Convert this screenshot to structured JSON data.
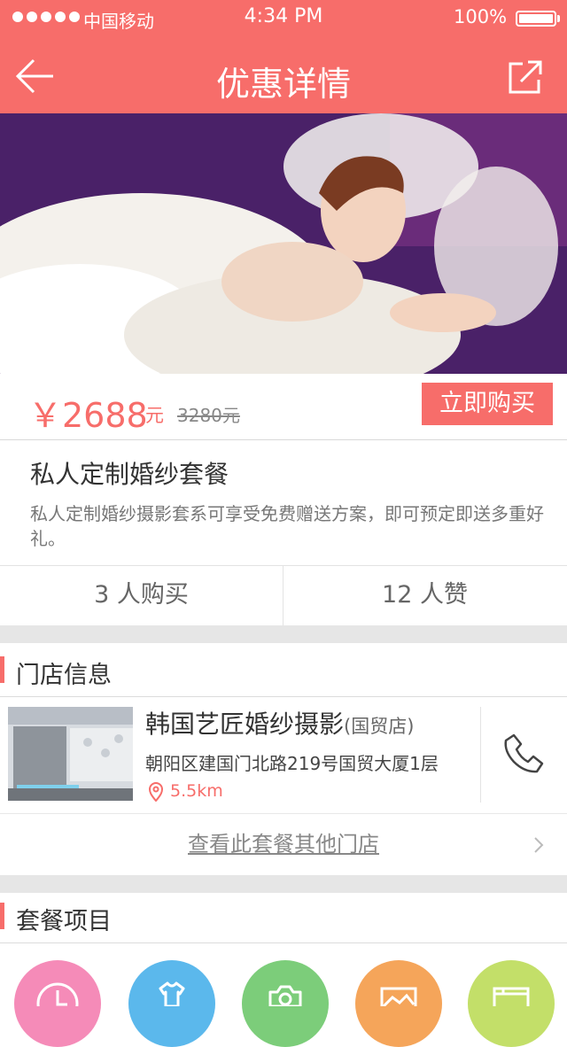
{
  "status_bar": {
    "carrier": "中国移动",
    "time": "4:34 PM",
    "battery": "100%"
  },
  "nav": {
    "title": "优惠详情"
  },
  "price": {
    "current": "￥2688",
    "unit": "元",
    "original": "3280元"
  },
  "buy_button": "立即购买",
  "package": {
    "title": "私人定制婚纱套餐",
    "description": "私人定制婚纱摄影套系可享受免费赠送方案，即可预定即送多重好礼。"
  },
  "stats": {
    "buyers": "3 人购买",
    "likes": "12 人赞"
  },
  "store_section": {
    "title": "门店信息"
  },
  "store": {
    "name": "韩国艺匠婚纱摄影",
    "branch": "(国贸店)",
    "address": "朝阳区建国门北路219号国贸大厦1层",
    "distance": "5.5km"
  },
  "more_stores_link": "查看此套餐其他门店",
  "package_items_section": {
    "title": "套餐项目"
  },
  "package_items": [
    {
      "icon": "clock-icon",
      "color": "#f58bb8"
    },
    {
      "icon": "shirt-icon",
      "color": "#5bb8ec"
    },
    {
      "icon": "camera-icon",
      "color": "#7ccd7a"
    },
    {
      "icon": "picture-icon",
      "color": "#f5a55a"
    },
    {
      "icon": "album-icon",
      "color": "#c3df69"
    }
  ],
  "colors": {
    "accent": "#f76d6a",
    "gap_gray": "#e6e6e6"
  }
}
